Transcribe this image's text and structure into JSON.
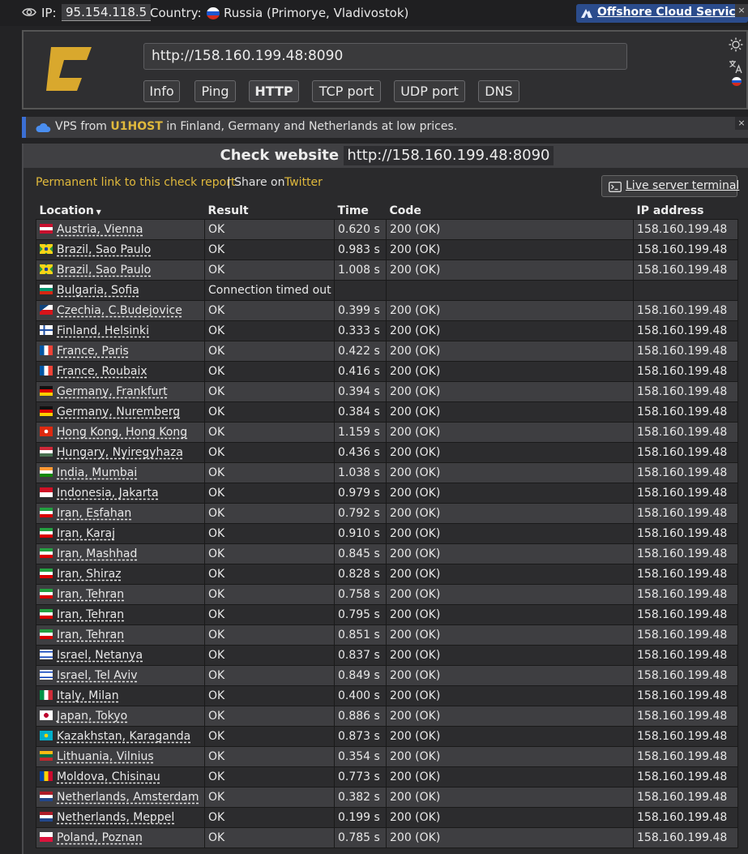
{
  "topbar": {
    "ip_label": "IP:",
    "ip_value": "95.154.118.5",
    "country_label": "Country:",
    "country_value": "Russia (Primorye, Vladivostok)",
    "ad_label": "Offshore Cloud Services",
    "ad_close": "×"
  },
  "header": {
    "url_value": "http://158.160.199.48:8090",
    "tabs": [
      {
        "label": "Info"
      },
      {
        "label": "Ping"
      },
      {
        "label": "HTTP"
      },
      {
        "label": "TCP port"
      },
      {
        "label": "UDP port"
      },
      {
        "label": "DNS"
      }
    ],
    "active_tab": "HTTP",
    "icons": [
      "sun-icon",
      "translate-icon",
      "russia-flag-icon"
    ]
  },
  "ad2": {
    "text_before": "VPS from",
    "brand": "U1HOST",
    "text_after": "in Finland, Germany and Netherlands at low prices.",
    "close": "×"
  },
  "panel": {
    "title_prefix": "Check website",
    "title_url": "http://158.160.199.48:8090",
    "permalink": "Permanent link to this check report",
    "separator": "|",
    "share_on": "Share on",
    "twitter": "Twitter",
    "terminal_button": "Live server terminal"
  },
  "table": {
    "headers": {
      "location": "Location",
      "result": "Result",
      "time": "Time",
      "code": "Code",
      "ip": "IP address"
    },
    "rows": [
      {
        "flag": "AT",
        "location": "Austria, Vienna",
        "result": "OK",
        "time": "0.620 s",
        "code": "200 (OK)",
        "ip": "158.160.199.48"
      },
      {
        "flag": "BR",
        "location": "Brazil, Sao Paulo",
        "result": "OK",
        "time": "0.983 s",
        "code": "200 (OK)",
        "ip": "158.160.199.48"
      },
      {
        "flag": "BR",
        "location": "Brazil, Sao Paulo",
        "result": "OK",
        "time": "1.008 s",
        "code": "200 (OK)",
        "ip": "158.160.199.48"
      },
      {
        "flag": "BG",
        "location": "Bulgaria, Sofia",
        "result": "Connection timed out",
        "time": "",
        "code": "",
        "ip": "",
        "error": true
      },
      {
        "flag": "CZ",
        "location": "Czechia, C.Budejovice",
        "result": "OK",
        "time": "0.399 s",
        "code": "200 (OK)",
        "ip": "158.160.199.48"
      },
      {
        "flag": "FI",
        "location": "Finland, Helsinki",
        "result": "OK",
        "time": "0.333 s",
        "code": "200 (OK)",
        "ip": "158.160.199.48"
      },
      {
        "flag": "FR",
        "location": "France, Paris",
        "result": "OK",
        "time": "0.422 s",
        "code": "200 (OK)",
        "ip": "158.160.199.48"
      },
      {
        "flag": "FR",
        "location": "France, Roubaix",
        "result": "OK",
        "time": "0.416 s",
        "code": "200 (OK)",
        "ip": "158.160.199.48"
      },
      {
        "flag": "DE",
        "location": "Germany, Frankfurt",
        "result": "OK",
        "time": "0.394 s",
        "code": "200 (OK)",
        "ip": "158.160.199.48"
      },
      {
        "flag": "DE",
        "location": "Germany, Nuremberg",
        "result": "OK",
        "time": "0.384 s",
        "code": "200 (OK)",
        "ip": "158.160.199.48"
      },
      {
        "flag": "HK",
        "location": "Hong Kong, Hong Kong",
        "result": "OK",
        "time": "1.159 s",
        "code": "200 (OK)",
        "ip": "158.160.199.48"
      },
      {
        "flag": "HU",
        "location": "Hungary, Nyiregyhaza",
        "result": "OK",
        "time": "0.436 s",
        "code": "200 (OK)",
        "ip": "158.160.199.48"
      },
      {
        "flag": "IN",
        "location": "India, Mumbai",
        "result": "OK",
        "time": "1.038 s",
        "code": "200 (OK)",
        "ip": "158.160.199.48"
      },
      {
        "flag": "ID",
        "location": "Indonesia, Jakarta",
        "result": "OK",
        "time": "0.979 s",
        "code": "200 (OK)",
        "ip": "158.160.199.48"
      },
      {
        "flag": "IR",
        "location": "Iran, Esfahan",
        "result": "OK",
        "time": "0.792 s",
        "code": "200 (OK)",
        "ip": "158.160.199.48"
      },
      {
        "flag": "IR",
        "location": "Iran, Karaj",
        "result": "OK",
        "time": "0.910 s",
        "code": "200 (OK)",
        "ip": "158.160.199.48"
      },
      {
        "flag": "IR",
        "location": "Iran, Mashhad",
        "result": "OK",
        "time": "0.845 s",
        "code": "200 (OK)",
        "ip": "158.160.199.48"
      },
      {
        "flag": "IR",
        "location": "Iran, Shiraz",
        "result": "OK",
        "time": "0.828 s",
        "code": "200 (OK)",
        "ip": "158.160.199.48"
      },
      {
        "flag": "IR",
        "location": "Iran, Tehran",
        "result": "OK",
        "time": "0.758 s",
        "code": "200 (OK)",
        "ip": "158.160.199.48"
      },
      {
        "flag": "IR",
        "location": "Iran, Tehran",
        "result": "OK",
        "time": "0.795 s",
        "code": "200 (OK)",
        "ip": "158.160.199.48"
      },
      {
        "flag": "IR",
        "location": "Iran, Tehran",
        "result": "OK",
        "time": "0.851 s",
        "code": "200 (OK)",
        "ip": "158.160.199.48"
      },
      {
        "flag": "IL",
        "location": "Israel, Netanya",
        "result": "OK",
        "time": "0.837 s",
        "code": "200 (OK)",
        "ip": "158.160.199.48"
      },
      {
        "flag": "IL",
        "location": "Israel, Tel Aviv",
        "result": "OK",
        "time": "0.849 s",
        "code": "200 (OK)",
        "ip": "158.160.199.48"
      },
      {
        "flag": "IT",
        "location": "Italy, Milan",
        "result": "OK",
        "time": "0.400 s",
        "code": "200 (OK)",
        "ip": "158.160.199.48"
      },
      {
        "flag": "JP",
        "location": "Japan, Tokyo",
        "result": "OK",
        "time": "0.886 s",
        "code": "200 (OK)",
        "ip": "158.160.199.48"
      },
      {
        "flag": "KZ",
        "location": "Kazakhstan, Karaganda",
        "result": "OK",
        "time": "0.873 s",
        "code": "200 (OK)",
        "ip": "158.160.199.48"
      },
      {
        "flag": "LT",
        "location": "Lithuania, Vilnius",
        "result": "OK",
        "time": "0.354 s",
        "code": "200 (OK)",
        "ip": "158.160.199.48"
      },
      {
        "flag": "MD",
        "location": "Moldova, Chisinau",
        "result": "OK",
        "time": "0.773 s",
        "code": "200 (OK)",
        "ip": "158.160.199.48"
      },
      {
        "flag": "NL",
        "location": "Netherlands, Amsterdam",
        "result": "OK",
        "time": "0.382 s",
        "code": "200 (OK)",
        "ip": "158.160.199.48"
      },
      {
        "flag": "NL",
        "location": "Netherlands, Meppel",
        "result": "OK",
        "time": "0.199 s",
        "code": "200 (OK)",
        "ip": "158.160.199.48"
      },
      {
        "flag": "PL",
        "location": "Poland, Poznan",
        "result": "OK",
        "time": "0.785 s",
        "code": "200 (OK)",
        "ip": "158.160.199.48"
      }
    ]
  },
  "colors": {
    "accent_gold": "#e0b93c",
    "error_red": "#e24b3b",
    "ad_blue": "#2b4c8c"
  }
}
